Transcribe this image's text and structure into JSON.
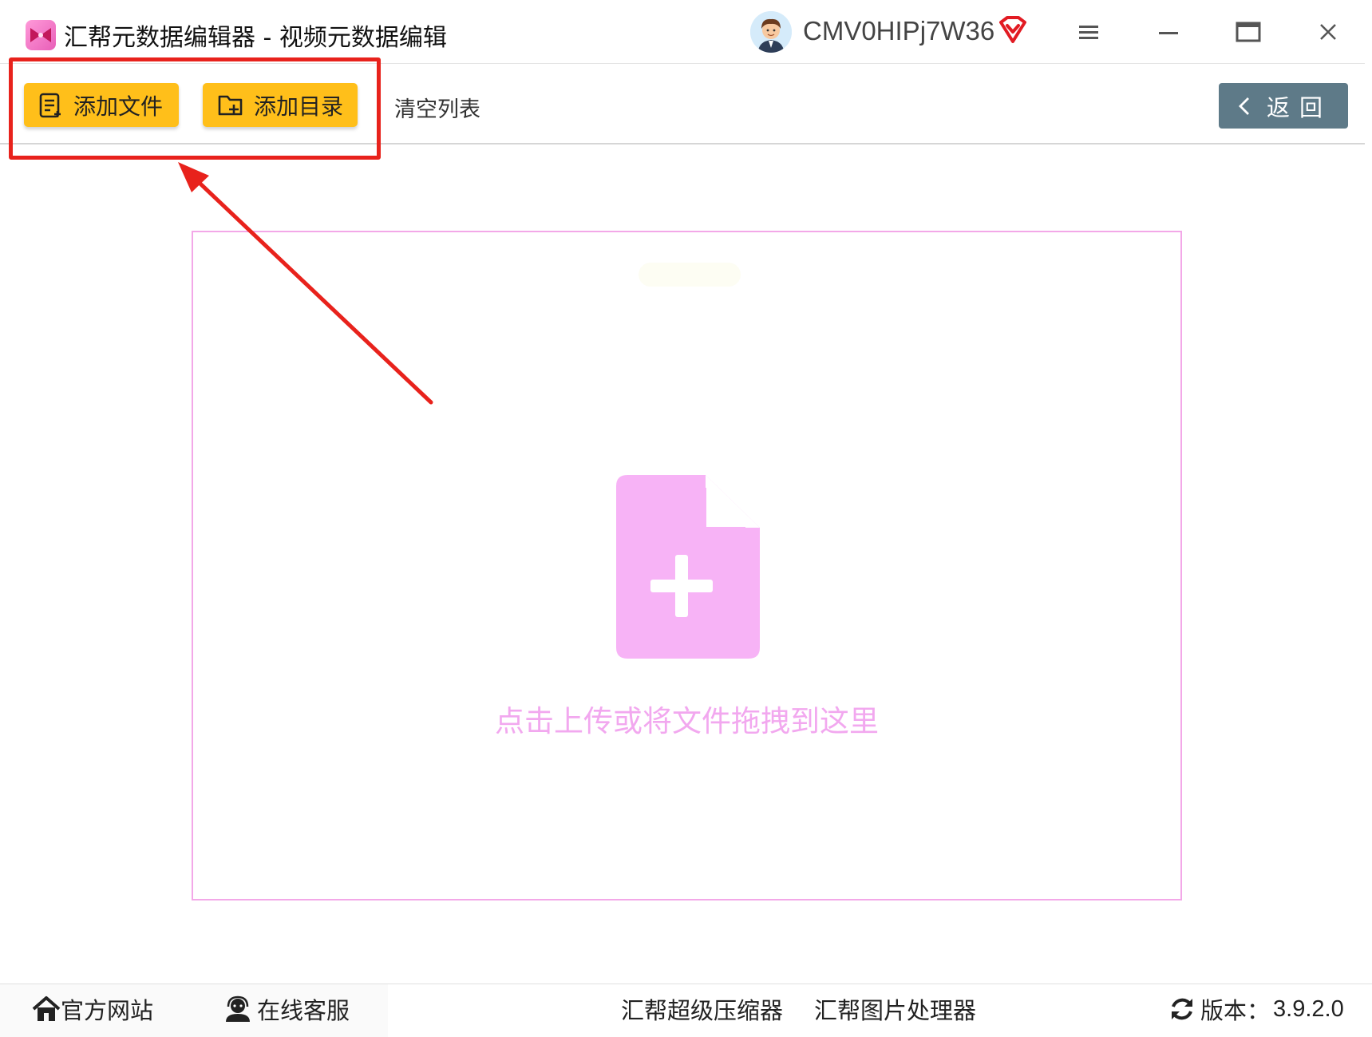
{
  "window": {
    "title": "汇帮元数据编辑器 - 视频元数据编辑",
    "username": "CMV0HIPj7W36",
    "icons": [
      "app-logo",
      "avatar",
      "vip-diamond-icon",
      "hamburger-menu-icon",
      "minimize-icon",
      "maximize-icon",
      "close-icon"
    ]
  },
  "toolbar": {
    "add_file_label": "添加文件",
    "add_dir_label": "添加目录",
    "clear_list_label": "清空列表",
    "back_label": "返回",
    "button_color": "#ffbf1a",
    "back_color": "#5e7a88"
  },
  "dropzone": {
    "hint_text": "点击上传或将文件拖拽到这里",
    "accent_color": "#f7b3f6"
  },
  "annotation": {
    "highlight_color": "#e8221c"
  },
  "statusbar": {
    "website_label": "官方网站",
    "support_label": "在线客服",
    "compressor_label": "汇帮超级压缩器",
    "image_processor_label": "汇帮图片处理器",
    "version_label": "版本：",
    "version_value": "3.9.2.0"
  }
}
